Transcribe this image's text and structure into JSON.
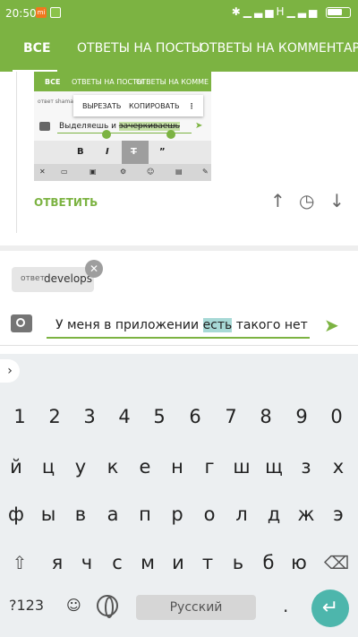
{
  "status": {
    "time": "20:50",
    "net": "H"
  },
  "tabs": [
    {
      "label": "ВСЕ"
    },
    {
      "label": "ОТВЕТЫ НА ПОСТЫ"
    },
    {
      "label": "ОТВЕТЫ НА КОММЕНТАРИИ"
    }
  ],
  "embedded": {
    "tabs": [
      "ВСЕ",
      "ОТВЕТЫ НА ПОСТЫ",
      "ОТВЕТЫ НА КОММЕ"
    ],
    "reply_chip": "ответ shama",
    "menu": [
      "ВЫРЕЗАТЬ",
      "КОПИРОВАТЬ"
    ],
    "input_text_before": "Выделяешь и ",
    "input_text_selected": "зачеркиваешь",
    "format_buttons": [
      "B",
      "I",
      "T",
      "”"
    ]
  },
  "comment": {
    "reply_label": "ОТВЕТИТЬ"
  },
  "reply_chip": {
    "prefix": "ответ",
    "name": "develops"
  },
  "message": {
    "before": "У меня в приложении ",
    "highlight": "есть",
    "after": " такого нет"
  },
  "keyboard": {
    "row1": [
      "1",
      "2",
      "3",
      "4",
      "5",
      "6",
      "7",
      "8",
      "9",
      "0"
    ],
    "row2": [
      "й",
      "ц",
      "у",
      "к",
      "е",
      "н",
      "г",
      "ш",
      "щ",
      "з",
      "х"
    ],
    "row3": [
      "ф",
      "ы",
      "в",
      "а",
      "п",
      "р",
      "о",
      "л",
      "д",
      "ж",
      "э"
    ],
    "row4": [
      "я",
      "ч",
      "с",
      "м",
      "и",
      "т",
      "ь",
      "б",
      "ю"
    ],
    "symbols_label": "?123",
    "space_label": "Русский",
    "period": "."
  },
  "colors": {
    "accent": "#7cb342",
    "highlight": "#a7d9d6",
    "enter": "#4db6ac"
  }
}
